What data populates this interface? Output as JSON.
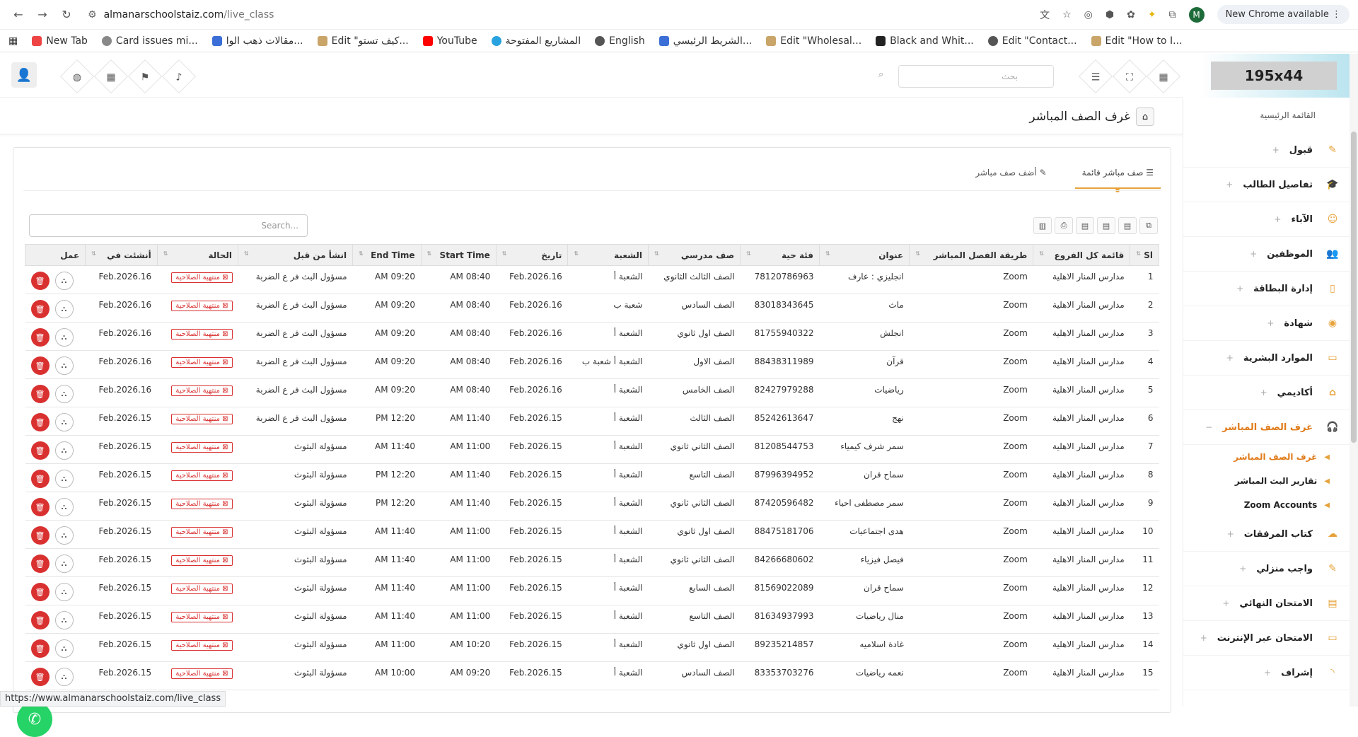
{
  "browser": {
    "url_host": "almanarschoolstaiz.com",
    "url_path": "/live_class",
    "profile_initial": "M",
    "new_chrome": "New Chrome available",
    "status_url": "https://www.almanarschoolstaiz.com/live_class",
    "bookmarks": [
      "New Tab",
      "Card issues mi...",
      "مقالات ذهب الوا...",
      "Edit \"كيف تستو...",
      "YouTube",
      "المشاريع المفتوحة",
      "English",
      "الشريط الرئيسي...",
      "Edit \"Wholesal...",
      "Black and Whit...",
      "Edit \"Contact...",
      "Edit \"How to I..."
    ]
  },
  "app": {
    "logo_text": "195x44",
    "search_placeholder": "بحث",
    "page_title": "غرف الصف المباشر",
    "sidebar": {
      "heading": "القائمة الرئيسية",
      "items": [
        {
          "label": "قبول"
        },
        {
          "label": "تفاصيل الطالب"
        },
        {
          "label": "الآباء"
        },
        {
          "label": "الموظفين"
        },
        {
          "label": "إدارة البطاقة"
        },
        {
          "label": "شهادة"
        },
        {
          "label": "الموارد البشرية"
        },
        {
          "label": "أكاديمي"
        },
        {
          "label": "غرف الصف المباشر"
        }
      ],
      "subitems": [
        {
          "label": "غرف الصف المباشر"
        },
        {
          "label": "تقارير البث المباشر"
        },
        {
          "label": "Zoom Accounts"
        }
      ],
      "items2": [
        {
          "label": "كتاب المرفقات"
        },
        {
          "label": "واجب منزلي"
        },
        {
          "label": "الامتحان النهائي"
        },
        {
          "label": "الامتحان عبر الإنترنت"
        },
        {
          "label": "إشراف"
        }
      ]
    },
    "tabs": {
      "list": "صف مباشر قائمة",
      "add": "أضف صف مباشر"
    },
    "table_search": "Search...",
    "columns": [
      "Sl",
      "قائمة كل الفروع",
      "طريقة الفصل المباشر",
      "عنوان",
      "فئة حية",
      "صف مدرسي",
      "الشعبة",
      "تاريخ",
      "Start Time",
      "End Time",
      "انشأ من قبل",
      "الحالة",
      "أنشئت في",
      "عمل"
    ],
    "status_label": "منتهية الصلاحية",
    "rows": [
      {
        "sl": "1",
        "branch": "مدارس المنار الاهلية",
        "method": "Zoom",
        "title": "انجليزي : عارف",
        "id": "78120786963",
        "class": "الصف الثالث الثانوي",
        "section": "الشعبة أ",
        "date": "16.Feb.2026",
        "start": "08:40 AM",
        "end": "09:20 AM",
        "by": "مسؤول البث فر ع الضربة",
        "created": "16.Feb.2026"
      },
      {
        "sl": "2",
        "branch": "مدارس المنار الاهلية",
        "method": "Zoom",
        "title": "ماث",
        "id": "83018343645",
        "class": "الصف السادس",
        "section": "شعبة ب",
        "date": "16.Feb.2026",
        "start": "08:40 AM",
        "end": "09:20 AM",
        "by": "مسؤول البث فر ع الضربة",
        "created": "16.Feb.2026"
      },
      {
        "sl": "3",
        "branch": "مدارس المنار الاهلية",
        "method": "Zoom",
        "title": "انجلش",
        "id": "81755940322",
        "class": "الصف اول ثانوي",
        "section": "الشعبة أ",
        "date": "16.Feb.2026",
        "start": "08:40 AM",
        "end": "09:20 AM",
        "by": "مسؤول البث فر ع الضربة",
        "created": "16.Feb.2026"
      },
      {
        "sl": "4",
        "branch": "مدارس المنار الاهلية",
        "method": "Zoom",
        "title": "قرآن",
        "id": "88438311989",
        "class": "الصف الاول",
        "section": "الشعبة أ شعبة ب",
        "date": "16.Feb.2026",
        "start": "08:40 AM",
        "end": "09:20 AM",
        "by": "مسؤول البث فر ع الضربة",
        "created": "16.Feb.2026"
      },
      {
        "sl": "5",
        "branch": "مدارس المنار الاهلية",
        "method": "Zoom",
        "title": "رياضيات",
        "id": "82427979288",
        "class": "الصف الخامس",
        "section": "الشعبة أ",
        "date": "16.Feb.2026",
        "start": "08:40 AM",
        "end": "09:20 AM",
        "by": "مسؤول البث فر ع الضربة",
        "created": "16.Feb.2026"
      },
      {
        "sl": "6",
        "branch": "مدارس المنار الاهلية",
        "method": "Zoom",
        "title": "نهج",
        "id": "85242613647",
        "class": "الصف الثالث",
        "section": "الشعبة أ",
        "date": "15.Feb.2026",
        "start": "11:40 AM",
        "end": "12:20 PM",
        "by": "مسؤول البث فر ع الضربة",
        "created": "15.Feb.2026"
      },
      {
        "sl": "7",
        "branch": "مدارس المنار الاهلية",
        "method": "Zoom",
        "title": "سمر شرف كيمياء",
        "id": "81208544753",
        "class": "الصف الثاني ثانوي",
        "section": "الشعبة أ",
        "date": "15.Feb.2026",
        "start": "11:00 AM",
        "end": "11:40 AM",
        "by": "مسؤولة البثوث",
        "created": "15.Feb.2026"
      },
      {
        "sl": "8",
        "branch": "مدارس المنار الاهلية",
        "method": "Zoom",
        "title": "سماح قران",
        "id": "87996394952",
        "class": "الصف التاسع",
        "section": "الشعبة أ",
        "date": "15.Feb.2026",
        "start": "11:40 AM",
        "end": "12:20 PM",
        "by": "مسؤولة البثوث",
        "created": "15.Feb.2026"
      },
      {
        "sl": "9",
        "branch": "مدارس المنار الاهلية",
        "method": "Zoom",
        "title": "سمر مصطفى احياء",
        "id": "87420596482",
        "class": "الصف الثاني ثانوي",
        "section": "الشعبة أ",
        "date": "15.Feb.2026",
        "start": "11:40 AM",
        "end": "12:20 PM",
        "by": "مسؤولة البثوث",
        "created": "15.Feb.2026"
      },
      {
        "sl": "10",
        "branch": "مدارس المنار الاهلية",
        "method": "Zoom",
        "title": "هدى اجتماعيات",
        "id": "88475181706",
        "class": "الصف اول ثانوي",
        "section": "الشعبة أ",
        "date": "15.Feb.2026",
        "start": "11:00 AM",
        "end": "11:40 AM",
        "by": "مسؤولة البثوث",
        "created": "15.Feb.2026"
      },
      {
        "sl": "11",
        "branch": "مدارس المنار الاهلية",
        "method": "Zoom",
        "title": "فيصل فيزياء",
        "id": "84266680602",
        "class": "الصف الثاني ثانوي",
        "section": "الشعبة أ",
        "date": "15.Feb.2026",
        "start": "11:00 AM",
        "end": "11:40 AM",
        "by": "مسؤولة البثوث",
        "created": "15.Feb.2026"
      },
      {
        "sl": "12",
        "branch": "مدارس المنار الاهلية",
        "method": "Zoom",
        "title": "سماح قران",
        "id": "81569022089",
        "class": "الصف السابع",
        "section": "الشعبة أ",
        "date": "15.Feb.2026",
        "start": "11:00 AM",
        "end": "11:40 AM",
        "by": "مسؤولة البثوث",
        "created": "15.Feb.2026"
      },
      {
        "sl": "13",
        "branch": "مدارس المنار الاهلية",
        "method": "Zoom",
        "title": "منال رياضيات",
        "id": "81634937993",
        "class": "الصف التاسع",
        "section": "الشعبة أ",
        "date": "15.Feb.2026",
        "start": "11:00 AM",
        "end": "11:40 AM",
        "by": "مسؤولة البثوث",
        "created": "15.Feb.2026"
      },
      {
        "sl": "14",
        "branch": "مدارس المنار الاهلية",
        "method": "Zoom",
        "title": "غادة اسلاميه",
        "id": "89235214857",
        "class": "الصف اول ثانوي",
        "section": "الشعبة أ",
        "date": "15.Feb.2026",
        "start": "10:20 AM",
        "end": "11:00 AM",
        "by": "مسؤولة البثوث",
        "created": "15.Feb.2026"
      },
      {
        "sl": "15",
        "branch": "مدارس المنار الاهلية",
        "method": "Zoom",
        "title": "نعمه رياضيات",
        "id": "83353703276",
        "class": "الصف السادس",
        "section": "الشعبة أ",
        "date": "15.Feb.2026",
        "start": "09:20 AM",
        "end": "10:00 AM",
        "by": "مسؤولة البثوث",
        "created": "15.Feb.2026"
      }
    ]
  }
}
